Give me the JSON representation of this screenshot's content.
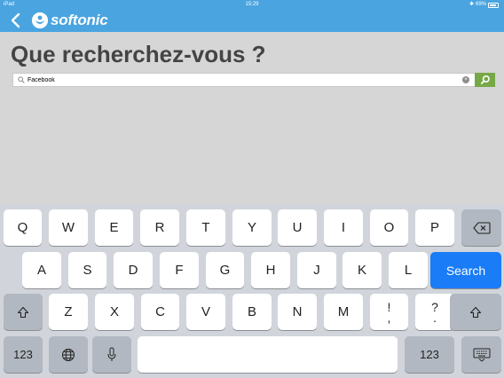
{
  "status_bar": {
    "device": "iPad",
    "time": "15:29",
    "battery": "69%"
  },
  "app": {
    "brand": "softonic",
    "colors": {
      "header": "#4aa4df",
      "search_button": "#76a845",
      "keyboard_action": "#1a7cf6"
    }
  },
  "page": {
    "title": "Que recherchez-vous ?"
  },
  "search": {
    "value": "Facebook"
  },
  "keyboard": {
    "row1": [
      "Q",
      "W",
      "E",
      "R",
      "T",
      "Y",
      "U",
      "I",
      "O",
      "P"
    ],
    "row2": [
      "A",
      "S",
      "D",
      "F",
      "G",
      "H",
      "J",
      "K",
      "L"
    ],
    "row3": [
      "Z",
      "X",
      "C",
      "V",
      "B",
      "N",
      "M"
    ],
    "action_label": "Search",
    "numbers_label": "123",
    "punct1_top": "!",
    "punct1_bottom": ",",
    "punct2_top": "?",
    "punct2_bottom": "."
  }
}
